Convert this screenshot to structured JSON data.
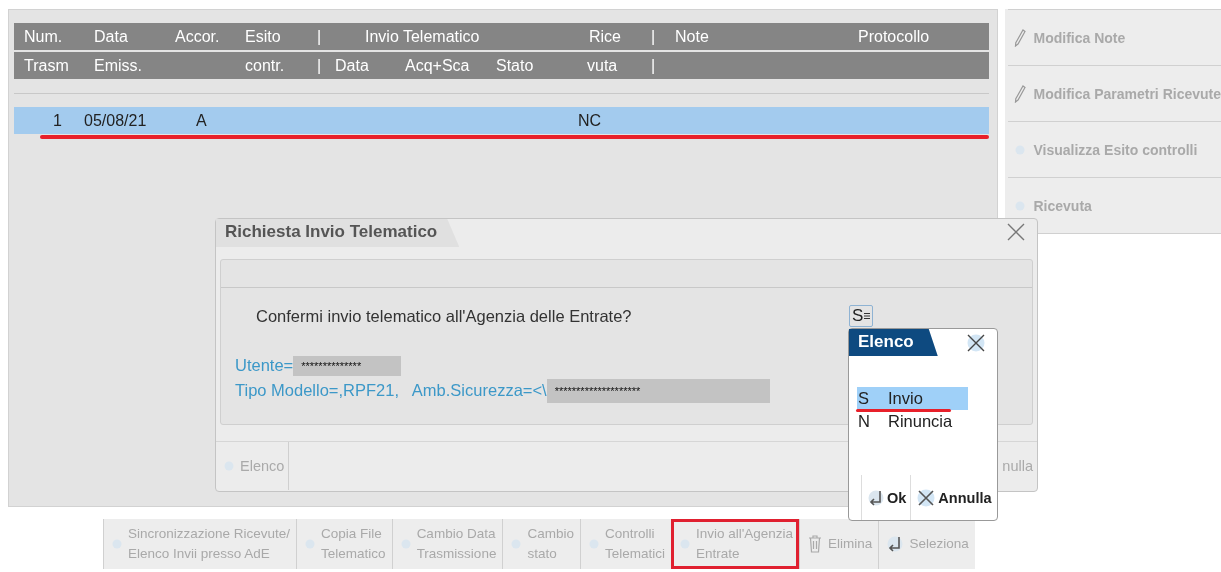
{
  "table": {
    "header_rows": [
      [
        "Num.",
        "Data",
        "Accor.",
        "Esito",
        "|",
        "Invio Telematico",
        "Rice",
        "|",
        "Note",
        "Protocollo"
      ],
      [
        "Trasm",
        "Emiss.",
        "contr.",
        "|",
        "Data",
        "Acq+Sca",
        "Stato",
        "vuta",
        "|"
      ]
    ],
    "rows": [
      {
        "cells": [
          "1",
          "05/08/21",
          "A",
          "NC"
        ],
        "selected": true,
        "highlighted": true
      }
    ]
  },
  "side_actions": [
    {
      "label": "Modifica Note",
      "kind": "pencil"
    },
    {
      "label": "Modifica Parametri Ricevute",
      "kind": "pencil"
    },
    {
      "label": "Visualizza Esito controlli",
      "kind": "dot"
    },
    {
      "label": "Ricevuta",
      "kind": "dot"
    }
  ],
  "dialog": {
    "title": "Richiesta Invio Telematico",
    "question": "Confermi invio telematico all'Agenzia delle Entrate?",
    "answer": "S",
    "info_lines": [
      {
        "label": "Utente=",
        "masked": "**************"
      },
      {
        "label": "Tipo Modello=,RPF21,   Amb.Sicurezza=<\\",
        "masked": "********************"
      }
    ],
    "buttons": [
      {
        "label": "Elenco",
        "kind": "dot"
      },
      {
        "label": "nulla",
        "kind": "plain"
      }
    ]
  },
  "popup": {
    "title": "Elenco",
    "items": [
      {
        "code": "S",
        "label": "Invio",
        "selected": true,
        "underlined": true
      },
      {
        "code": "N",
        "label": "Rinuncia",
        "selected": false,
        "underlined": false
      }
    ],
    "buttons": [
      {
        "label": "Ok",
        "kind": "enter"
      },
      {
        "label": "Annulla",
        "kind": "close"
      }
    ]
  },
  "toolbar": [
    {
      "label": "Sincronizzazione Ricevute/\nElenco Invii presso AdE",
      "kind": "dot",
      "highlighted": false
    },
    {
      "label": "Copia File\nTelematico",
      "kind": "dot",
      "highlighted": false
    },
    {
      "label": "Cambio Data\nTrasmissione",
      "kind": "dot",
      "highlighted": false
    },
    {
      "label": "Cambio\nstato",
      "kind": "dot",
      "highlighted": false
    },
    {
      "label": "Controlli\nTelematici",
      "kind": "dot",
      "highlighted": false
    },
    {
      "label": "Invio all'Agenzia\nEntrate",
      "kind": "dot",
      "highlighted": true
    },
    {
      "label": "Elimina",
      "kind": "trash",
      "highlighted": false
    },
    {
      "label": "Seleziona",
      "kind": "enter",
      "highlighted": false
    }
  ]
}
